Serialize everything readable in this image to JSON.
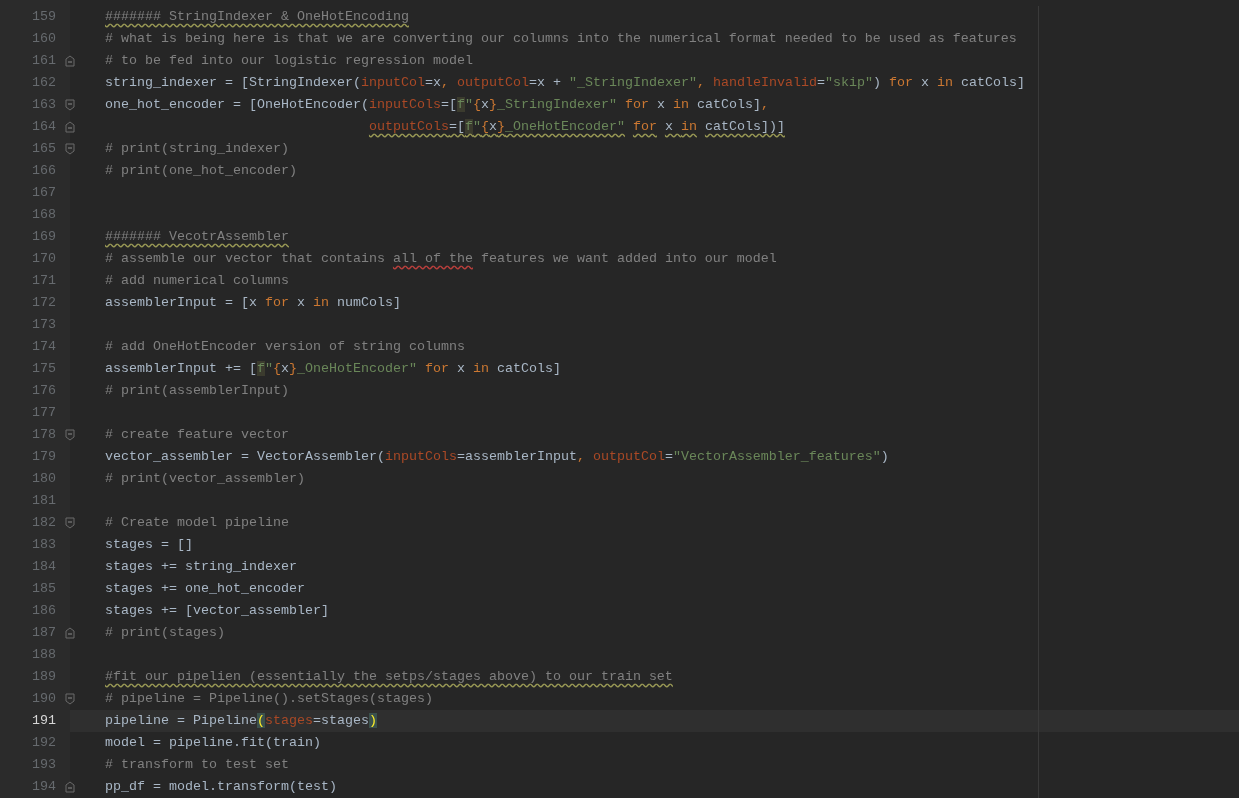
{
  "editor": {
    "lines": [
      {
        "number": "159",
        "current": false,
        "kind": "plain",
        "tokens": [
          {
            "kind": "comment",
            "text": "####### StringIndexer & OneHotEncoding",
            "warning": true
          }
        ]
      },
      {
        "number": "160",
        "current": false,
        "kind": "plain",
        "tokens": [
          {
            "kind": "comment",
            "text": "# what is being here is that we are converting our columns into the numerical format needed to be used as features"
          }
        ]
      },
      {
        "number": "161",
        "current": false,
        "kind": "foldend",
        "tokens": [
          {
            "kind": "comment",
            "text": "# to be fed into our logistic regression model"
          }
        ]
      },
      {
        "number": "162",
        "current": false,
        "kind": "plain",
        "tokens": [
          {
            "kind": "code",
            "text": "string_indexer = [StringIndexer("
          },
          {
            "kind": "param",
            "text": "inputCol"
          },
          {
            "kind": "code",
            "text": "=x"
          },
          {
            "kind": "keyword",
            "text": ", "
          },
          {
            "kind": "param",
            "text": "outputCol"
          },
          {
            "kind": "code",
            "text": "=x + "
          },
          {
            "kind": "string",
            "text": "\"_StringIndexer\""
          },
          {
            "kind": "keyword",
            "text": ", "
          },
          {
            "kind": "param",
            "text": "handleInvalid"
          },
          {
            "kind": "code",
            "text": "="
          },
          {
            "kind": "string",
            "text": "\"skip\""
          },
          {
            "kind": "code",
            "text": ") "
          },
          {
            "kind": "keyword",
            "text": "for"
          },
          {
            "kind": "code",
            "text": " x "
          },
          {
            "kind": "keyword",
            "text": "in"
          },
          {
            "kind": "code",
            "text": " catCols]"
          }
        ]
      },
      {
        "number": "163",
        "current": false,
        "kind": "foldstart",
        "tokens": [
          {
            "kind": "code",
            "text": "one_hot_encoder = [OneHotEncoder("
          },
          {
            "kind": "param",
            "text": "inputCols"
          },
          {
            "kind": "code",
            "text": "=["
          },
          {
            "kind": "fprefix",
            "text": "f"
          },
          {
            "kind": "string",
            "text": "\""
          },
          {
            "kind": "brace",
            "text": "{"
          },
          {
            "kind": "code",
            "text": "x"
          },
          {
            "kind": "brace",
            "text": "}"
          },
          {
            "kind": "string",
            "text": "_StringIndexer\""
          },
          {
            "kind": "keyword",
            "text": " for"
          },
          {
            "kind": "code",
            "text": " x "
          },
          {
            "kind": "keyword",
            "text": "in"
          },
          {
            "kind": "code",
            "text": " catCols]"
          },
          {
            "kind": "keyword",
            "text": ","
          }
        ]
      },
      {
        "number": "164",
        "current": false,
        "kind": "foldend",
        "tokens": [
          {
            "kind": "param",
            "text": "                                 outputCols",
            "warning": true
          },
          {
            "kind": "code",
            "text": "=[",
            "warning": true
          },
          {
            "kind": "fprefix",
            "text": "f",
            "warning": true
          },
          {
            "kind": "string",
            "text": "\"",
            "warning": true
          },
          {
            "kind": "brace",
            "text": "{",
            "warning": true
          },
          {
            "kind": "code",
            "text": "x",
            "warning": true
          },
          {
            "kind": "brace",
            "text": "}",
            "warning": true
          },
          {
            "kind": "string",
            "text": "_OneHotEncoder\"",
            "warning": true
          },
          {
            "kind": "keyword",
            "text": " for",
            "warning": true
          },
          {
            "kind": "code",
            "text": " x ",
            "warning": true
          },
          {
            "kind": "keyword",
            "text": "in",
            "warning": true
          },
          {
            "kind": "code",
            "text": " catCols])]",
            "warning": true
          }
        ]
      },
      {
        "number": "165",
        "current": false,
        "kind": "foldstart",
        "tokens": [
          {
            "kind": "comment",
            "text": "# print(string_indexer)"
          }
        ]
      },
      {
        "number": "166",
        "current": false,
        "kind": "plain",
        "tokens": [
          {
            "kind": "comment",
            "text": "# print(one_hot_encoder)"
          }
        ]
      },
      {
        "number": "167",
        "current": false,
        "kind": "plain"
      },
      {
        "number": "168",
        "current": false,
        "kind": "plain"
      },
      {
        "number": "169",
        "current": false,
        "kind": "plain",
        "tokens": [
          {
            "kind": "comment",
            "text": "####### VecotrAssembler",
            "warning": true
          }
        ]
      },
      {
        "number": "170",
        "current": false,
        "kind": "plain",
        "tokens": [
          {
            "kind": "comment",
            "text": "# assemble our vector that contains "
          },
          {
            "kind": "comment",
            "text": "all of the",
            "typo": true
          },
          {
            "kind": "comment",
            "text": " features we want added into our model"
          }
        ]
      },
      {
        "number": "171",
        "current": false,
        "kind": "plain",
        "tokens": [
          {
            "kind": "comment",
            "text": "# add numerical columns"
          }
        ]
      },
      {
        "number": "172",
        "current": false,
        "kind": "plain",
        "tokens": [
          {
            "kind": "code",
            "text": "assemblerInput = [x "
          },
          {
            "kind": "keyword",
            "text": "for"
          },
          {
            "kind": "code",
            "text": " x "
          },
          {
            "kind": "keyword",
            "text": "in"
          },
          {
            "kind": "code",
            "text": " numCols]"
          }
        ]
      },
      {
        "number": "173",
        "current": false,
        "kind": "plain"
      },
      {
        "number": "174",
        "current": false,
        "kind": "plain",
        "tokens": [
          {
            "kind": "comment",
            "text": "# add OneHotEncoder version of string columns"
          }
        ]
      },
      {
        "number": "175",
        "current": false,
        "kind": "plain",
        "tokens": [
          {
            "kind": "code",
            "text": "assemblerInput += ["
          },
          {
            "kind": "fprefix",
            "text": "f"
          },
          {
            "kind": "string",
            "text": "\""
          },
          {
            "kind": "brace",
            "text": "{"
          },
          {
            "kind": "code",
            "text": "x"
          },
          {
            "kind": "brace",
            "text": "}"
          },
          {
            "kind": "string",
            "text": "_OneHotEncoder\""
          },
          {
            "kind": "keyword",
            "text": " for"
          },
          {
            "kind": "code",
            "text": " x "
          },
          {
            "kind": "keyword",
            "text": "in"
          },
          {
            "kind": "code",
            "text": " catCols]"
          }
        ]
      },
      {
        "number": "176",
        "current": false,
        "kind": "plain",
        "tokens": [
          {
            "kind": "comment",
            "text": "# print(assemblerInput)"
          }
        ]
      },
      {
        "number": "177",
        "current": false,
        "kind": "plain"
      },
      {
        "number": "178",
        "current": false,
        "kind": "foldstart",
        "tokens": [
          {
            "kind": "comment",
            "text": "# create feature vector"
          }
        ]
      },
      {
        "number": "179",
        "current": false,
        "kind": "plain",
        "tokens": [
          {
            "kind": "code",
            "text": "vector_assembler = VectorAssembler("
          },
          {
            "kind": "param",
            "text": "inputCols"
          },
          {
            "kind": "code",
            "text": "=assemblerInput"
          },
          {
            "kind": "keyword",
            "text": ", "
          },
          {
            "kind": "param",
            "text": "outputCol"
          },
          {
            "kind": "code",
            "text": "="
          },
          {
            "kind": "string",
            "text": "\"VectorAssembler_features\""
          },
          {
            "kind": "code",
            "text": ")"
          }
        ]
      },
      {
        "number": "180",
        "current": false,
        "kind": "plain",
        "tokens": [
          {
            "kind": "comment",
            "text": "# print(vector_assembler)"
          }
        ]
      },
      {
        "number": "181",
        "current": false,
        "kind": "plain"
      },
      {
        "number": "182",
        "current": false,
        "kind": "foldstart",
        "tokens": [
          {
            "kind": "comment",
            "text": "# Create model pipeline"
          }
        ]
      },
      {
        "number": "183",
        "current": false,
        "kind": "plain",
        "tokens": [
          {
            "kind": "code",
            "text": "stages = []"
          }
        ]
      },
      {
        "number": "184",
        "current": false,
        "kind": "plain",
        "tokens": [
          {
            "kind": "code",
            "text": "stages += string_indexer"
          }
        ]
      },
      {
        "number": "185",
        "current": false,
        "kind": "plain",
        "tokens": [
          {
            "kind": "code",
            "text": "stages += one_hot_encoder"
          }
        ]
      },
      {
        "number": "186",
        "current": false,
        "kind": "plain",
        "tokens": [
          {
            "kind": "code",
            "text": "stages += [vector_assembler]"
          }
        ]
      },
      {
        "number": "187",
        "current": false,
        "kind": "foldend",
        "tokens": [
          {
            "kind": "comment",
            "text": "# print(stages)"
          }
        ]
      },
      {
        "number": "188",
        "current": false,
        "kind": "plain"
      },
      {
        "number": "189",
        "current": false,
        "kind": "plain",
        "tokens": [
          {
            "kind": "comment",
            "text": "#fit our pipelien (essentially the setps/stages above) to our train set",
            "warning": true
          }
        ]
      },
      {
        "number": "190",
        "current": false,
        "kind": "foldstart",
        "tokens": [
          {
            "kind": "comment",
            "text": "# pipeline = Pipeline().setStages(stages)"
          }
        ]
      },
      {
        "number": "191",
        "current": true,
        "kind": "plain",
        "tokens": [
          {
            "kind": "code",
            "text": "pipeline = Pipeline"
          },
          {
            "kind": "match",
            "text": "("
          },
          {
            "kind": "param",
            "text": "stages"
          },
          {
            "kind": "code",
            "text": "=stages"
          },
          {
            "kind": "match",
            "text": ")"
          }
        ]
      },
      {
        "number": "192",
        "current": false,
        "kind": "plain",
        "tokens": [
          {
            "kind": "code",
            "text": "model = pipeline.fit(train)"
          }
        ]
      },
      {
        "number": "193",
        "current": false,
        "kind": "plain",
        "tokens": [
          {
            "kind": "comment",
            "text": "# transform to test set"
          }
        ]
      },
      {
        "number": "194",
        "current": false,
        "kind": "foldend",
        "tokens": [
          {
            "kind": "code",
            "text": "pp_df = model.transform(test)"
          }
        ]
      }
    ]
  }
}
